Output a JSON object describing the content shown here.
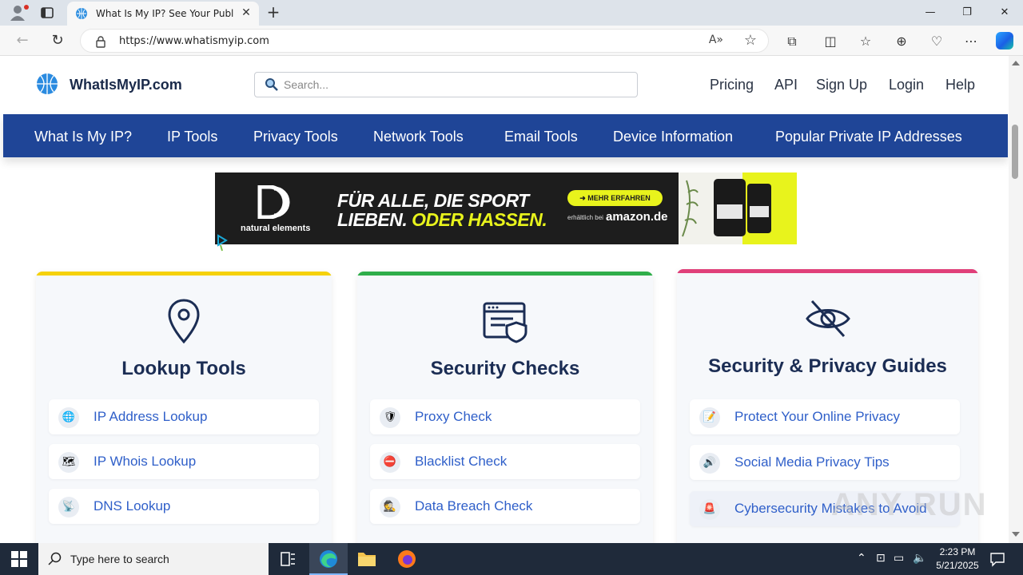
{
  "browser": {
    "tab_title": "What Is My IP? See Your Public IP",
    "url": "https://www.whatismyip.com"
  },
  "site": {
    "logo_text": "WhatIsMyIP.com",
    "search_placeholder": "Search...",
    "top_nav": [
      "Pricing",
      "API",
      "Sign Up",
      "Login",
      "Help"
    ],
    "main_nav": [
      "What Is My IP?",
      "IP Tools",
      "Privacy Tools",
      "Network Tools",
      "Email Tools",
      "Device Information",
      "Popular Private IP Addresses"
    ]
  },
  "ad": {
    "brand": "natural elements",
    "line1": "FÜR ALLE, DIE SPORT",
    "line2a": "LIEBEN. ",
    "line2b": "ODER HASSEN.",
    "cta": "➜ MEHR ERFAHREN",
    "available": "erhältlich bei",
    "store": "amazon.de"
  },
  "cards": [
    {
      "title": "Lookup Tools",
      "accent": "#f5d10a",
      "icon": "location-pin-icon",
      "links": [
        {
          "label": "IP Address Lookup",
          "icon": "globe-icon"
        },
        {
          "label": "IP Whois Lookup",
          "icon": "map-icon"
        },
        {
          "label": "DNS Lookup",
          "icon": "satellite-icon"
        }
      ]
    },
    {
      "title": "Security Checks",
      "accent": "#2fae4a",
      "icon": "browser-shield-icon",
      "links": [
        {
          "label": "Proxy Check",
          "icon": "shield-icon"
        },
        {
          "label": "Blacklist Check",
          "icon": "no-entry-icon"
        },
        {
          "label": "Data Breach Check",
          "icon": "detective-icon"
        }
      ]
    },
    {
      "title": "Security & Privacy Guides",
      "accent": "#e0407a",
      "icon": "eye-slash-icon",
      "links": [
        {
          "label": "Protect Your Online Privacy",
          "icon": "memo-icon"
        },
        {
          "label": "Social Media Privacy Tips",
          "icon": "speaker-icon"
        },
        {
          "label": "Cybersecurity Mistakes to Avoid",
          "icon": "siren-icon"
        }
      ]
    }
  ],
  "watermark": "ANY RUN",
  "taskbar": {
    "search_placeholder": "Type here to search",
    "time": "2:23 PM",
    "date": "5/21/2025"
  },
  "colors": {
    "nav_bg": "#1f4597",
    "link": "#2f5fc9",
    "title": "#1b2d54"
  }
}
